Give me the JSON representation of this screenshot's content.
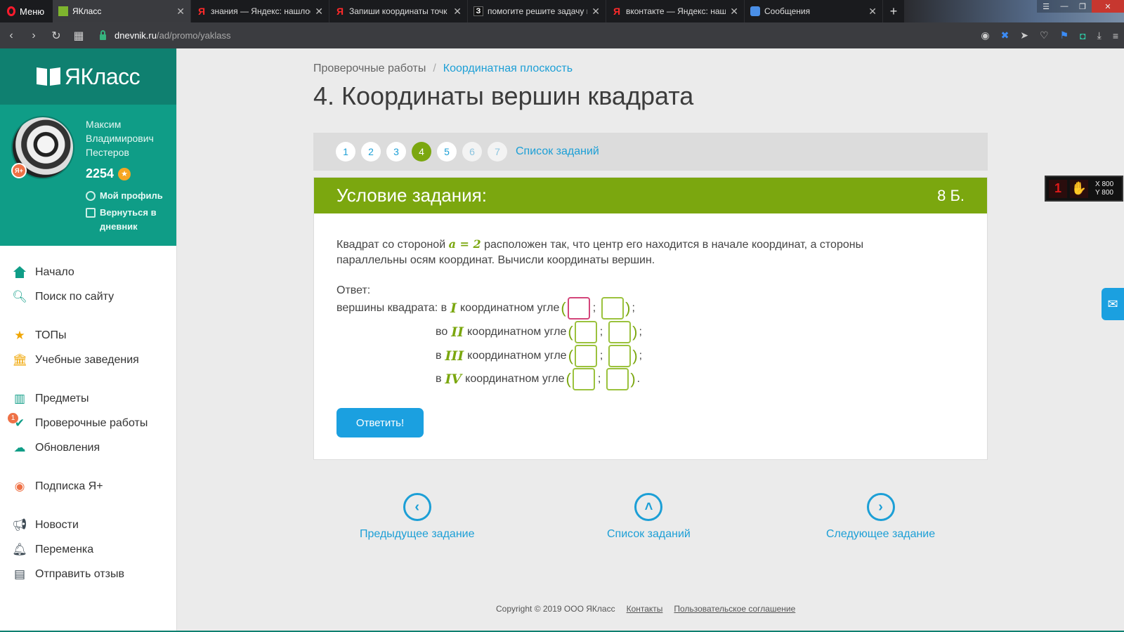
{
  "browser": {
    "menu_label": "Меню",
    "tabs": [
      {
        "title": "ЯКласс",
        "favicon": "yaklass-icon",
        "active": true
      },
      {
        "title": "знания — Яндекс: нашлос",
        "favicon": "yandex-icon"
      },
      {
        "title": "Запиши координаты точк",
        "favicon": "yandex-icon"
      },
      {
        "title": "помогите решите задачу г",
        "favicon": "znanija-icon"
      },
      {
        "title": "вконтакте — Яндекс: наш",
        "favicon": "yandex-icon"
      },
      {
        "title": "Сообщения",
        "favicon": "messages-icon"
      }
    ],
    "url_host": "dnevnik.ru",
    "url_path": "/ad/promo/yaklass"
  },
  "sidebar": {
    "logo_text": "ЯКласс",
    "user_name": "Максим Владимирович Пестеров",
    "points": "2254",
    "profile_link": "Мой профиль",
    "back_link": "Вернуться в дневник",
    "items": [
      {
        "label": "Начало",
        "icon": "home-icon"
      },
      {
        "label": "Поиск по сайту",
        "icon": "search-icon"
      },
      {
        "label": "ТОПы",
        "icon": "star-icon"
      },
      {
        "label": "Учебные заведения",
        "icon": "school-icon"
      },
      {
        "label": "Предметы",
        "icon": "books-icon"
      },
      {
        "label": "Проверочные работы",
        "icon": "check-icon",
        "badge": "1"
      },
      {
        "label": "Обновления",
        "icon": "cloud-upload-icon"
      },
      {
        "label": "Подписка Я+",
        "icon": "ya-plus-icon"
      },
      {
        "label": "Новости",
        "icon": "megaphone-icon"
      },
      {
        "label": "Переменка",
        "icon": "bell-icon"
      },
      {
        "label": "Отправить отзыв",
        "icon": "feedback-icon"
      }
    ]
  },
  "main": {
    "breadcrumb_root": "Проверочные работы",
    "breadcrumb_current": "Координатная плоскость",
    "title": "4. Координаты вершин квадрата",
    "pager": {
      "pages": [
        "1",
        "2",
        "3",
        "4",
        "5",
        "6",
        "7"
      ],
      "current": "4",
      "list_link": "Список заданий"
    },
    "task": {
      "header": "Условие задания:",
      "points": "8 Б.",
      "text_before": "Квадрат со стороной ",
      "math": "a = 2",
      "text_after": " расположен так, что центр его находится в начале координат, а стороны параллельны осям координат. Вычисли координаты вершин.",
      "answer_label": "Ответ:",
      "rows": [
        {
          "prefix": "вершины квадрата: в",
          "roman": "I",
          "suffix": "координатном угле",
          "end": ";"
        },
        {
          "prefix": "во",
          "roman": "II",
          "suffix": "координатном угле",
          "end": ";"
        },
        {
          "prefix": "в",
          "roman": "III",
          "suffix": "координатном угле",
          "end": ";"
        },
        {
          "prefix": "в",
          "roman": "IV",
          "suffix": "координатном угле",
          "end": "."
        }
      ],
      "submit_label": "Ответить!"
    },
    "nav": {
      "prev": "Предыдущее задание",
      "list": "Список заданий",
      "next": "Следующее задание"
    }
  },
  "footer": {
    "copyright": "Copyright © 2019 ООО ЯКласс",
    "contacts": "Контакты",
    "agreement": "Пользовательское соглашение"
  },
  "widget": {
    "x": "X 800",
    "y": "Y 800"
  },
  "colors": {
    "brand_teal": "#0f9d87",
    "task_green": "#7ba70f",
    "link_blue": "#1c9fd6",
    "button_blue": "#1ba0e0"
  }
}
